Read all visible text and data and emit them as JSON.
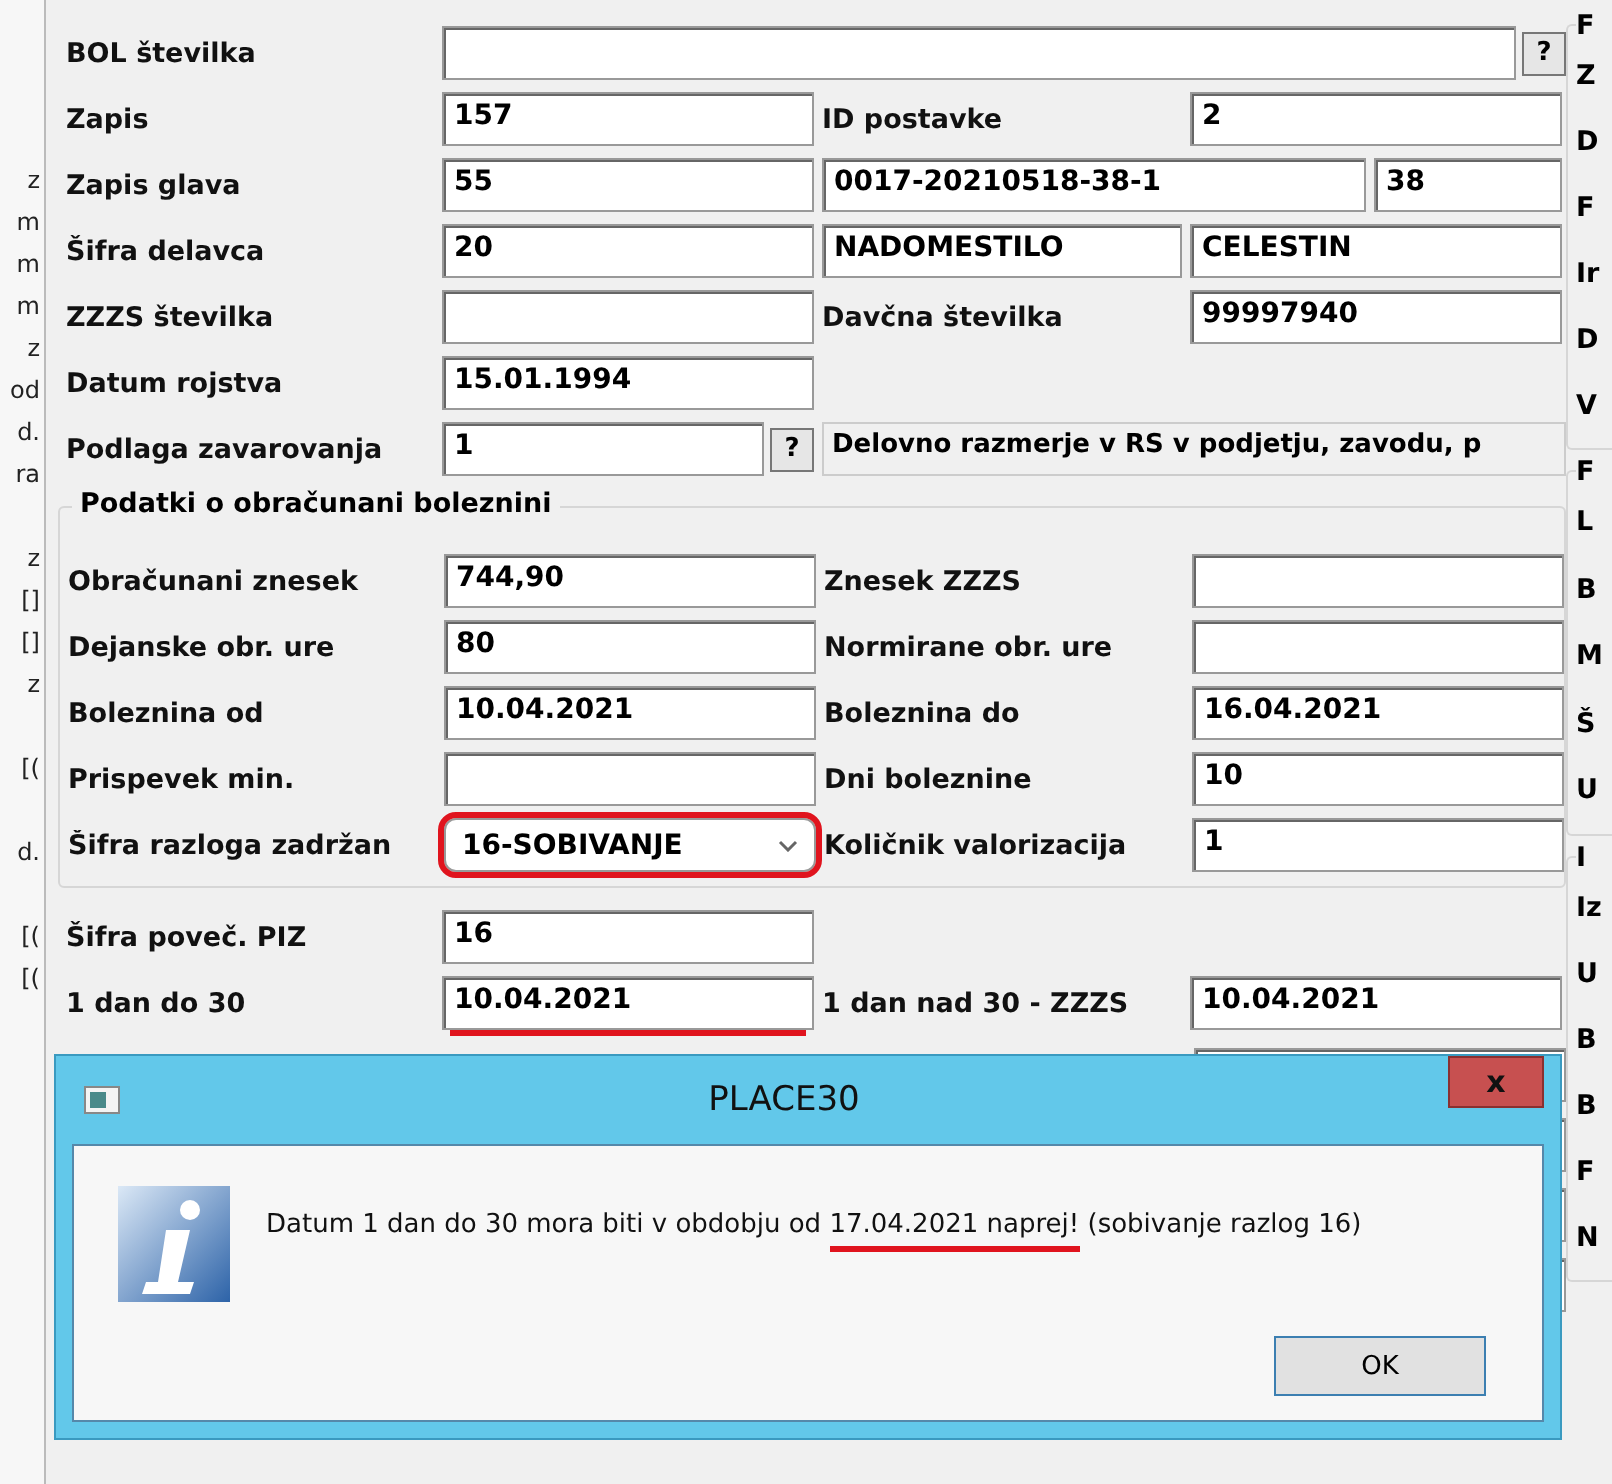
{
  "left_strip": [
    "z",
    "m",
    "m",
    "m",
    "z",
    "od",
    "d.",
    "ra",
    "z",
    "[]",
    "[]",
    "z",
    "[(",
    "d.",
    "[(",
    "[("
  ],
  "rows": [
    {
      "kind": "wide",
      "cells": [
        {
          "kind": "label",
          "text": "BOL številka"
        },
        {
          "kind": "field-help",
          "text": "",
          "help": "?"
        }
      ]
    },
    {
      "kind": "quad",
      "cells": [
        {
          "kind": "label",
          "text": "Zapis"
        },
        {
          "kind": "field",
          "text": "157"
        },
        {
          "kind": "label",
          "text": "ID postavke"
        },
        {
          "kind": "field",
          "text": "2"
        }
      ]
    },
    {
      "kind": "code",
      "cells": [
        {
          "kind": "label",
          "text": "Zapis glava"
        },
        {
          "kind": "field",
          "text": "55"
        },
        {
          "kind": "field",
          "text": "0017-20210518-38-1"
        },
        {
          "kind": "field",
          "text": "38"
        }
      ]
    },
    {
      "kind": "quad",
      "cells": [
        {
          "kind": "label",
          "text": "Šifra delavca"
        },
        {
          "kind": "field",
          "text": "20"
        },
        {
          "kind": "field",
          "text": "NADOMESTILO"
        },
        {
          "kind": "field",
          "text": "CELESTIN"
        }
      ]
    },
    {
      "kind": "quad",
      "cells": [
        {
          "kind": "label",
          "text": "ZZZS številka"
        },
        {
          "kind": "field",
          "text": ""
        },
        {
          "kind": "label",
          "text": "Davčna številka"
        },
        {
          "kind": "field",
          "text": "99997940"
        }
      ]
    },
    {
      "kind": "pair",
      "cells": [
        {
          "kind": "label",
          "text": "Datum rojstva"
        },
        {
          "kind": "field",
          "text": "15.01.1994"
        }
      ]
    },
    {
      "kind": "basis",
      "cells": [
        {
          "kind": "label",
          "text": "Podlaga zavarovanja"
        },
        {
          "kind": "field-help",
          "text": "1",
          "help": "?"
        },
        {
          "kind": "desc",
          "text": "Delovno razmerje v RS v podjetju, zavodu, p"
        }
      ]
    }
  ],
  "group": {
    "title": "Podatki o obračunani boleznini",
    "rows": [
      {
        "kind": "quad",
        "cells": [
          {
            "kind": "label",
            "text": "Obračunani znesek"
          },
          {
            "kind": "field",
            "text": "744,90"
          },
          {
            "kind": "label",
            "text": "Znesek ZZZS"
          },
          {
            "kind": "field",
            "text": ""
          }
        ]
      },
      {
        "kind": "quad",
        "cells": [
          {
            "kind": "label",
            "text": "Dejanske obr. ure"
          },
          {
            "kind": "field",
            "text": "80"
          },
          {
            "kind": "label",
            "text": "Normirane obr. ure"
          },
          {
            "kind": "field",
            "text": ""
          }
        ]
      },
      {
        "kind": "quad",
        "cells": [
          {
            "kind": "label",
            "text": "Boleznina od"
          },
          {
            "kind": "field",
            "text": "10.04.2021"
          },
          {
            "kind": "label",
            "text": "Boleznina do"
          },
          {
            "kind": "field",
            "text": "16.04.2021"
          }
        ]
      },
      {
        "kind": "quad",
        "cells": [
          {
            "kind": "label",
            "text": "Prispevek min."
          },
          {
            "kind": "field",
            "text": ""
          },
          {
            "kind": "label",
            "text": "Dni boleznine"
          },
          {
            "kind": "field",
            "text": "10"
          }
        ]
      },
      {
        "kind": "quad",
        "cells": [
          {
            "kind": "label",
            "text": "Šifra razloga zadržan"
          },
          {
            "kind": "combo",
            "text": "16-SOBIVANJE",
            "annotated": true
          },
          {
            "kind": "label",
            "text": "Količnik valorizacija"
          },
          {
            "kind": "field",
            "text": "1"
          }
        ]
      }
    ]
  },
  "rows_after": [
    {
      "kind": "pair",
      "cells": [
        {
          "kind": "label",
          "text": "Šifra poveč. PIZ"
        },
        {
          "kind": "field",
          "text": "16"
        }
      ]
    },
    {
      "kind": "quad",
      "cells": [
        {
          "kind": "label",
          "text": "1 dan do 30"
        },
        {
          "kind": "field",
          "text": "10.04.2021",
          "annotated": true
        },
        {
          "kind": "label",
          "text": "1 dan nad 30 - ZZZS"
        },
        {
          "kind": "field",
          "text": "10.04.2021"
        }
      ]
    }
  ],
  "right_panel": [
    {
      "title": "F",
      "letters": [
        "Z",
        "D",
        "F",
        "Ir",
        "D",
        "V"
      ]
    },
    {
      "title": "F",
      "letters": [
        "L",
        "B",
        "M",
        "Š",
        "U"
      ]
    },
    {
      "title": "I",
      "letters": [
        "Iz",
        "U",
        "B",
        "B",
        "F",
        "N"
      ]
    }
  ],
  "dialog": {
    "title": "PLACE30",
    "close": "x",
    "message": [
      {
        "text": "Datum 1 dan do 30 mora biti v obdobju od ",
        "annotated": false
      },
      {
        "text": "17.04.2021 naprej!",
        "annotated": true
      },
      {
        "text": " (sobivanje razlog 16)",
        "annotated": false
      }
    ],
    "button": "OK"
  }
}
